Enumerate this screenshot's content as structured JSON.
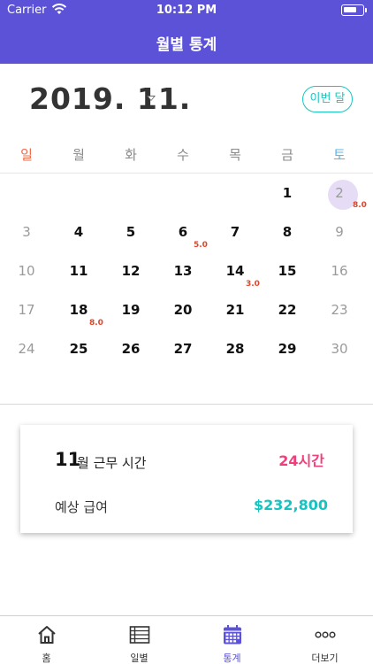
{
  "status_bar": {
    "carrier": "Carrier",
    "time": "10:12 PM",
    "battery_level": 0.75
  },
  "header": {
    "title": "월별 통계"
  },
  "month_selector": {
    "label": "2019. 11.",
    "this_month_button": "이번 달"
  },
  "calendar": {
    "weekdays": [
      {
        "label": "일",
        "color": "#ef6b4a"
      },
      {
        "label": "월",
        "color": "#8a8a8a"
      },
      {
        "label": "화",
        "color": "#8a8a8a"
      },
      {
        "label": "수",
        "color": "#8a8a8a"
      },
      {
        "label": "목",
        "color": "#8a8a8a"
      },
      {
        "label": "금",
        "color": "#8a8a8a"
      },
      {
        "label": "토",
        "color": "#5ab7e8"
      }
    ],
    "selected_day": "2",
    "weeks": [
      [
        "",
        "",
        "",
        "",
        "",
        "1",
        "2"
      ],
      [
        "3",
        "4",
        "5",
        "6",
        "7",
        "8",
        "9"
      ],
      [
        "10",
        "11",
        "12",
        "13",
        "14",
        "15",
        "16"
      ],
      [
        "17",
        "18",
        "19",
        "20",
        "21",
        "22",
        "23"
      ],
      [
        "24",
        "25",
        "26",
        "27",
        "28",
        "29",
        "30"
      ]
    ],
    "hours": {
      "2": "8.0",
      "6": "5.0",
      "14": "3.0",
      "18": "8.0"
    }
  },
  "summary": {
    "month": "11",
    "work_time_label": "월 근무 시간",
    "work_hours": "24시간",
    "expected_pay_label": "예상 급여",
    "expected_pay": "$232,800"
  },
  "tabbar": {
    "active_index": 2,
    "tabs": [
      {
        "label": "홈",
        "icon": "home-icon"
      },
      {
        "label": "일별",
        "icon": "list-icon"
      },
      {
        "label": "통계",
        "icon": "calendar-icon"
      },
      {
        "label": "더보기",
        "icon": "more-icon"
      }
    ]
  },
  "colors": {
    "primary": "#5b52d8",
    "accent_teal": "#18c6c0",
    "accent_pink": "#ef3f7c",
    "hours_red": "#e0452b",
    "selected_circle": "#e6dcf6"
  }
}
